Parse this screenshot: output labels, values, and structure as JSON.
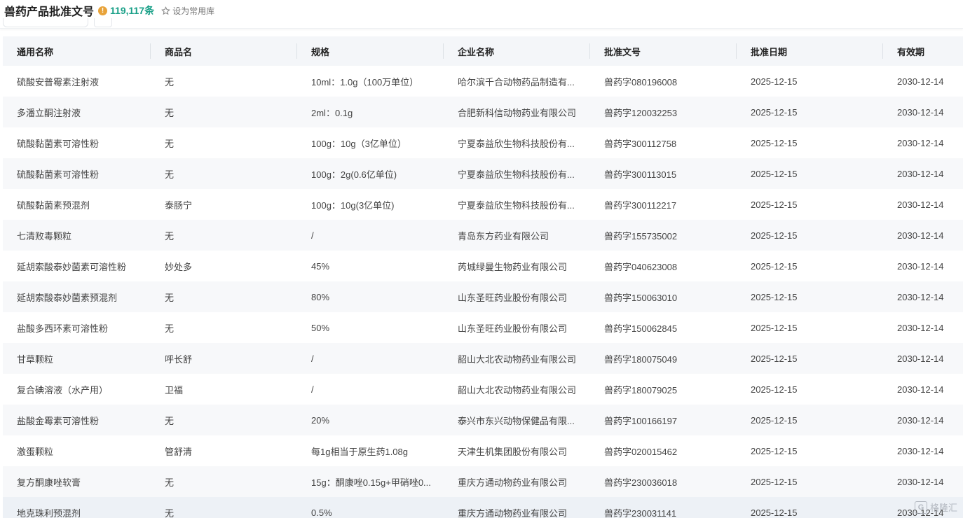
{
  "header": {
    "title": "兽药产品批准文号",
    "info_icon": "info-icon",
    "count": "119,117条",
    "favorite_label": "设为常用库"
  },
  "table": {
    "columns": [
      "通用名称",
      "商品名",
      "规格",
      "企业名称",
      "批准文号",
      "批准日期",
      "有效期"
    ],
    "rows": [
      [
        "硫酸安普霉素注射液",
        "无",
        "10ml：1.0g（100万单位）",
        "哈尔滨千合动物药品制造有...",
        "兽药字080196008",
        "2025-12-15",
        "2030-12-14"
      ],
      [
        "多潘立酮注射液",
        "无",
        "2ml：0.1g",
        "合肥新科信动物药业有限公司",
        "兽药字120032253",
        "2025-12-15",
        "2030-12-14"
      ],
      [
        "硫酸黏菌素可溶性粉",
        "无",
        "100g：10g（3亿单位）",
        "宁夏泰益欣生物科技股份有...",
        "兽药字300112758",
        "2025-12-15",
        "2030-12-14"
      ],
      [
        "硫酸黏菌素可溶性粉",
        "无",
        "100g：2g(0.6亿单位)",
        "宁夏泰益欣生物科技股份有...",
        "兽药字300113015",
        "2025-12-15",
        "2030-12-14"
      ],
      [
        "硫酸黏菌素预混剂",
        "泰肠宁",
        "100g：10g(3亿单位)",
        "宁夏泰益欣生物科技股份有...",
        "兽药字300112217",
        "2025-12-15",
        "2030-12-14"
      ],
      [
        "七清败毒颗粒",
        "无",
        "/",
        "青岛东方药业有限公司",
        "兽药字155735002",
        "2025-12-15",
        "2030-12-14"
      ],
      [
        "延胡索酸泰妙菌素可溶性粉",
        "妙处多",
        "45%",
        "芮城绿曼生物药业有限公司",
        "兽药字040623008",
        "2025-12-15",
        "2030-12-14"
      ],
      [
        "延胡索酸泰妙菌素预混剂",
        "无",
        "80%",
        "山东圣旺药业股份有限公司",
        "兽药字150063010",
        "2025-12-15",
        "2030-12-14"
      ],
      [
        "盐酸多西环素可溶性粉",
        "无",
        "50%",
        "山东圣旺药业股份有限公司",
        "兽药字150062845",
        "2025-12-15",
        "2030-12-14"
      ],
      [
        "甘草颗粒",
        "呼长舒",
        "/",
        "韶山大北农动物药业有限公司",
        "兽药字180075049",
        "2025-12-15",
        "2030-12-14"
      ],
      [
        "复合碘溶液（水产用）",
        "卫福",
        "/",
        "韶山大北农动物药业有限公司",
        "兽药字180079025",
        "2025-12-15",
        "2030-12-14"
      ],
      [
        "盐酸金霉素可溶性粉",
        "无",
        "20%",
        "泰兴市东兴动物保健品有限...",
        "兽药字100166197",
        "2025-12-15",
        "2030-12-14"
      ],
      [
        "激蛋颗粒",
        "管舒清",
        "每1g相当于原生药1.08g",
        "天津生机集团股份有限公司",
        "兽药字020015462",
        "2025-12-15",
        "2030-12-14"
      ],
      [
        "复方酮康唑软膏",
        "无",
        "15g：酮康唑0.15g+甲硝唑0...",
        "重庆方通动物药业有限公司",
        "兽药字230036018",
        "2025-12-15",
        "2030-12-14"
      ],
      [
        "地克珠利预混剂",
        "无",
        "0.5%",
        "重庆方通动物药业有限公司",
        "兽药字230031141",
        "2025-12-15",
        "2030-12-14"
      ]
    ]
  },
  "watermark": {
    "text": "格隆汇",
    "icon": "G"
  }
}
